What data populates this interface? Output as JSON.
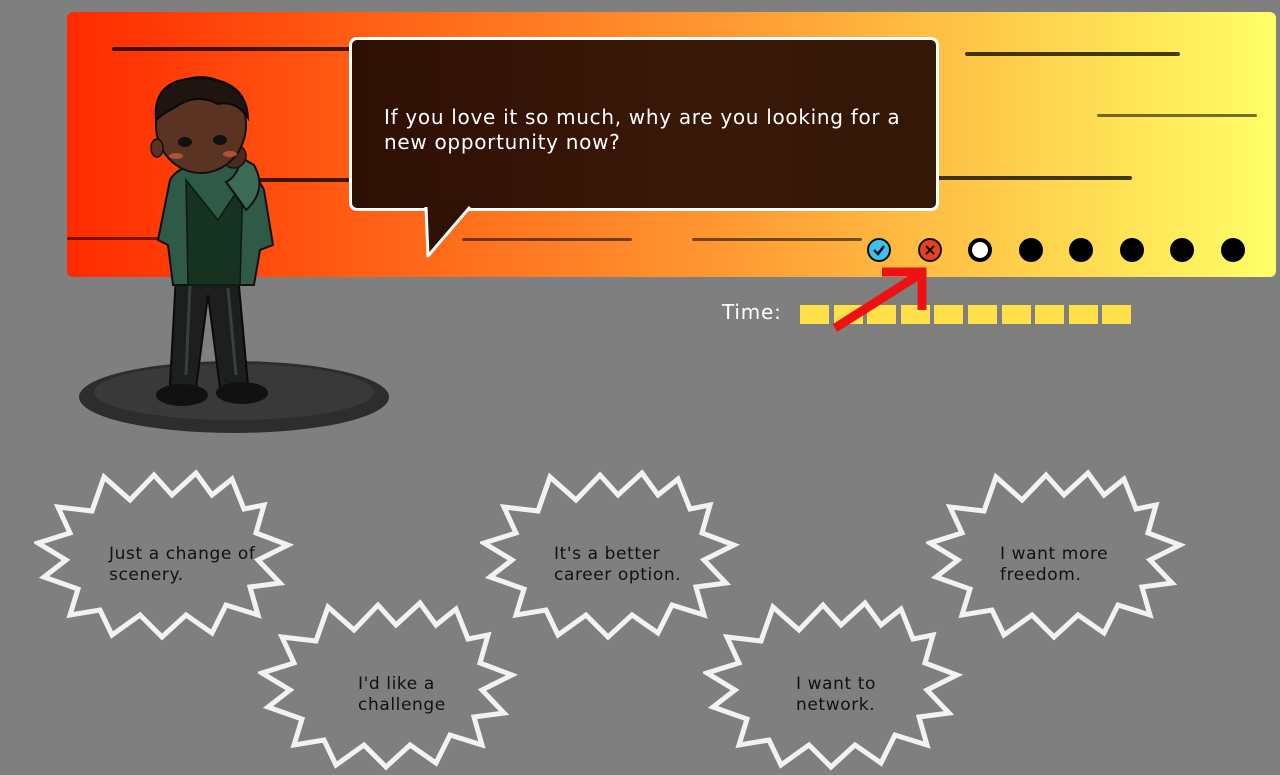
{
  "question": {
    "text": "If you love it so much, why are you looking for a new opportunity now?"
  },
  "progress": {
    "states": [
      "correct",
      "wrong",
      "current",
      "pending",
      "pending",
      "pending",
      "pending",
      "pending"
    ],
    "colors": {
      "correct": "#3cc0f0",
      "wrong": "#e8401c",
      "pending": "#000000"
    },
    "icons": {
      "correct": "check-icon",
      "wrong": "x-icon"
    }
  },
  "timer": {
    "label": "Time:",
    "remaining_segments": 10,
    "color": "#ffe14a"
  },
  "annotation": {
    "color": "#ee1111",
    "icon": "red-arrow-icon"
  },
  "choices": [
    {
      "id": "scenery",
      "text_lines": [
        "Just a change of",
        "scenery."
      ]
    },
    {
      "id": "challenge",
      "text_lines": [
        "I'd like a",
        "challenge"
      ]
    },
    {
      "id": "career",
      "text_lines": [
        "It's a better",
        "career option."
      ]
    },
    {
      "id": "network",
      "text_lines": [
        "I want to",
        "network."
      ]
    },
    {
      "id": "freedom",
      "text_lines": [
        "I want more",
        "freedom."
      ]
    }
  ]
}
